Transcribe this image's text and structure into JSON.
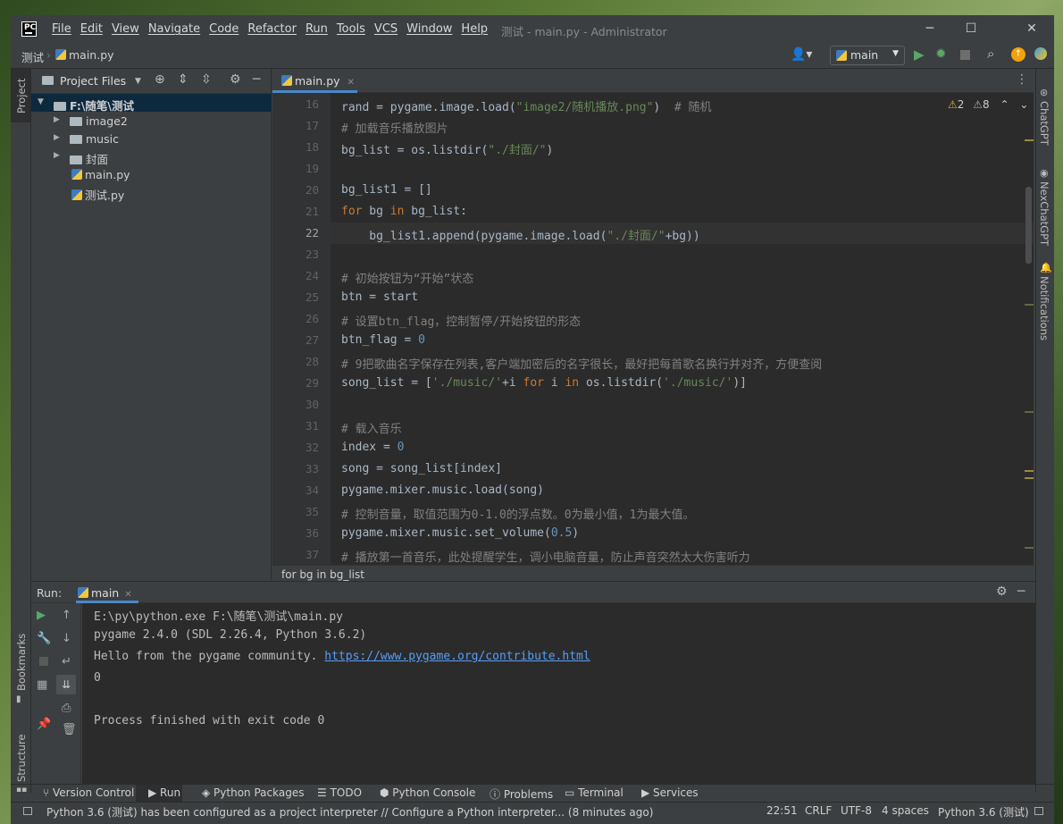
{
  "menu": [
    "File",
    "Edit",
    "View",
    "Navigate",
    "Code",
    "Refactor",
    "Run",
    "Tools",
    "VCS",
    "Window",
    "Help"
  ],
  "window_title": "测试 - main.py - Administrator",
  "logo": "PC",
  "breadcrumb": {
    "project": "测试",
    "file": "main.py"
  },
  "run_config": "main",
  "left_strip": {
    "project": "Project",
    "bookmarks": "Bookmarks",
    "structure": "Structure"
  },
  "right_strip": {
    "chatgpt": "ChatGPT",
    "nexchatgpt": "NexChatGPT",
    "notifications": "Notifications"
  },
  "project_panel": {
    "title": "Project Files",
    "tree": [
      {
        "label": "F:\\随笔\\测试",
        "type": "root"
      },
      {
        "label": "image2",
        "type": "folder"
      },
      {
        "label": "music",
        "type": "folder"
      },
      {
        "label": "封面",
        "type": "folder"
      },
      {
        "label": "main.py",
        "type": "file"
      },
      {
        "label": "测试.py",
        "type": "file"
      }
    ]
  },
  "editor": {
    "tab": "main.py",
    "warnings": {
      "w1": "2",
      "w2": "8"
    },
    "current_line": "22",
    "line_numbers": [
      "16",
      "17",
      "18",
      "19",
      "20",
      "21",
      "22",
      "23",
      "24",
      "25",
      "26",
      "27",
      "28",
      "29",
      "30",
      "31",
      "32",
      "33",
      "34",
      "35",
      "36",
      "37"
    ],
    "code": [
      "rand = pygame.image.load(\"image2/随机播放.png\")  # 随机",
      "# 加载音乐播放图片",
      "bg_list = os.listdir(\"./封面/\")",
      "",
      "bg_list1 = []",
      "for bg in bg_list:",
      "    bg_list1.append(pygame.image.load(\"./封面/\"+bg))",
      "",
      "# 初始按钮为“开始”状态",
      "btn = start",
      "# 设置btn_flag，控制暂停/开始按钮的形态",
      "btn_flag = 0",
      "# 9把歌曲名字保存在列表,客户端加密后的名字很长，最好把每首歌名换行并对齐，方便查阅",
      "song_list = ['./music/'+i for i in os.listdir('./music/')]",
      "",
      "# 载入音乐",
      "index = 0",
      "song = song_list[index]",
      "pygame.mixer.music.load(song)",
      "# 控制音量，取值范围为0-1.0的浮点数。0为最小值，1为最大值。",
      "pygame.mixer.music.set_volume(0.5)",
      "# 播放第一首音乐，此处提醒学生，调小电脑音量，防止声音突然太大伤害听力"
    ],
    "breadcrumb": "for bg in bg_list"
  },
  "run_panel": {
    "label": "Run:",
    "tab": "main",
    "output": [
      "E:\\py\\python.exe F:\\随笔\\测试\\main.py",
      "pygame 2.4.0 (SDL 2.26.4, Python 3.6.2)",
      "Hello from the pygame community. ",
      "0",
      "",
      "Process finished with exit code 0"
    ],
    "link": "https://www.pygame.org/contribute.html"
  },
  "tool_windows": [
    "Version Control",
    "Run",
    "Python Packages",
    "TODO",
    "Python Console",
    "Problems",
    "Terminal",
    "Services"
  ],
  "status": {
    "message": "Python 3.6 (测试) has been configured as a project interpreter // Configure a Python interpreter... (8 minutes ago)",
    "position": "22:51",
    "line_sep": "CRLF",
    "encoding": "UTF-8",
    "indent": "4 spaces",
    "interpreter": "Python 3.6 (测试)"
  }
}
